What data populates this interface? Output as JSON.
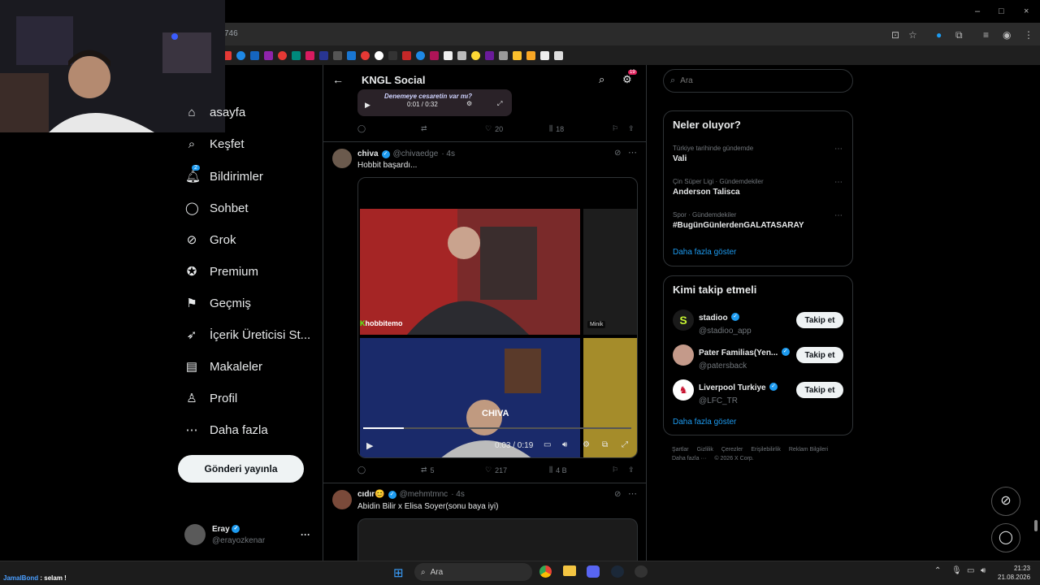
{
  "browser": {
    "url_fragment": "746",
    "window_controls": [
      "–",
      "□",
      "×"
    ]
  },
  "sidebar": {
    "items": [
      {
        "label": "asayfa",
        "icon": "home-icon"
      },
      {
        "label": "Keşfet",
        "icon": "search-icon"
      },
      {
        "label": "Bildirimler",
        "icon": "bell-icon",
        "badge": "2"
      },
      {
        "label": "Sohbet",
        "icon": "chat-icon"
      },
      {
        "label": "Grok",
        "icon": "grok-icon"
      },
      {
        "label": "Premium",
        "icon": "premium-icon"
      },
      {
        "label": "Geçmiş",
        "icon": "bookmark-icon"
      },
      {
        "label": "İçerik Üreticisi St...",
        "icon": "rocket-icon"
      },
      {
        "label": "Makaleler",
        "icon": "article-icon"
      },
      {
        "label": "Profil",
        "icon": "person-icon"
      },
      {
        "label": "Daha fazla",
        "icon": "more-icon"
      }
    ],
    "post_button": "Gönderi yayınla",
    "account": {
      "name": "Eray",
      "handle": "@erayozkenar",
      "more": "···"
    }
  },
  "header": {
    "title": "KNGL Social",
    "settings_badge": "19"
  },
  "tweets": [
    {
      "video_text": "Denemeye cesaretin var mı?",
      "video_time": "0:01 / 0:32",
      "retweets": "",
      "likes": "20",
      "views": "18"
    },
    {
      "name": "chiva",
      "handle": "@chivaedge",
      "time": "· 4s",
      "text": "Hobbit başardı...",
      "video_tag": "hobbitemo",
      "video_tag2": "Minik",
      "video_tag3": "CHIVA",
      "video_time": "0:03 / 0:19",
      "retweets": "5",
      "likes": "217",
      "views": "4 B"
    },
    {
      "name": "cıdır😊",
      "handle": "@mehmtmnc",
      "time": "· 4s",
      "text": "Abidin Bilir x Elisa Soyer(sonu baya iyi)"
    }
  ],
  "search": {
    "placeholder": "Ara"
  },
  "trends": {
    "title": "Neler oluyor?",
    "items": [
      {
        "context": "Türkiye tarihinde gündemde",
        "name": "Vali"
      },
      {
        "context": "Çin Süper Ligi · Gündemdekiler",
        "name": "Anderson Talisca"
      },
      {
        "context": "Spor · Gündemdekiler",
        "name": "#BugünGünlerdenGALATASARAY"
      }
    ],
    "show_more": "Daha fazla göster"
  },
  "who_to_follow": {
    "title": "Kimi takip etmeli",
    "items": [
      {
        "name": "stadioo",
        "handle": "@stadioo_app"
      },
      {
        "name": "Pater Familias(Yen...",
        "handle": "@patersback"
      },
      {
        "name": "Liverpool Turkiye",
        "handle": "@LFC_TR"
      }
    ],
    "follow_label": "Takip et",
    "show_more": "Daha fazla göster"
  },
  "footer": {
    "links": [
      "Şartlar",
      "Gizlilik",
      "Çerezler",
      "Erişilebilirlik",
      "Reklam Bilgileri",
      "Daha fazla ···",
      "© 2026 X Corp."
    ]
  },
  "taskbar": {
    "search_placeholder": "Ara",
    "time": "21:23",
    "date": "21.08.2026",
    "chat_user": "JamalBond",
    "chat_msg": ": selam !"
  },
  "colors": {
    "accent": "#1d9bf0",
    "bg": "#000000",
    "border": "#2f3336"
  }
}
